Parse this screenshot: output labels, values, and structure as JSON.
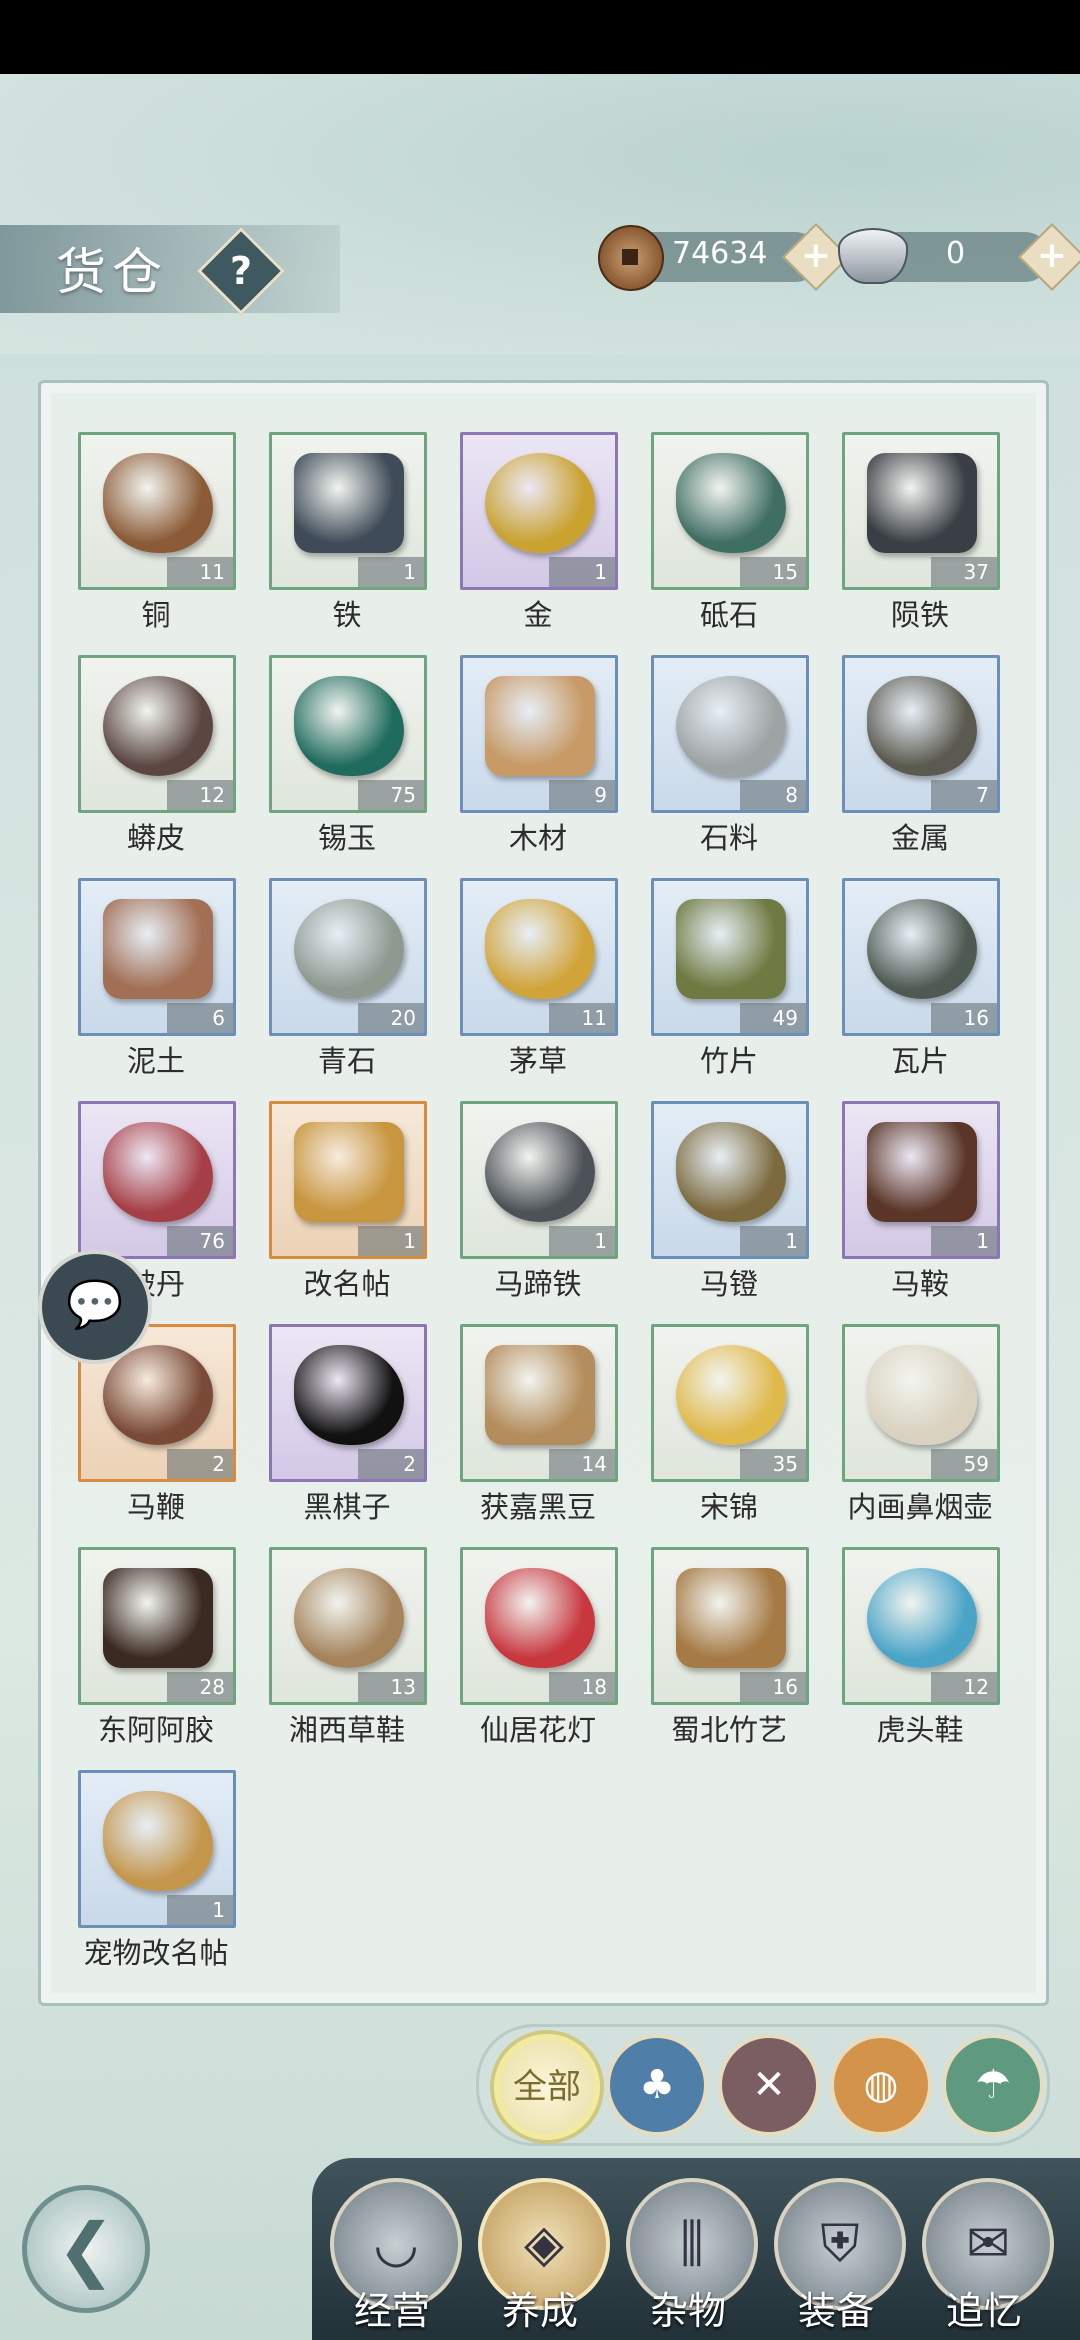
{
  "header": {
    "title": "货仓",
    "help_glyph": "?"
  },
  "currency": {
    "coins": {
      "value": "74634",
      "icon": "copper-coin-icon"
    },
    "silver": {
      "value": "0",
      "icon": "silver-ingot-icon"
    },
    "add_glyph": "+"
  },
  "items": [
    {
      "name": "铜",
      "count": "11",
      "rarity": "green"
    },
    {
      "name": "铁",
      "count": "1",
      "rarity": "green"
    },
    {
      "name": "金",
      "count": "1",
      "rarity": "purple"
    },
    {
      "name": "砥石",
      "count": "15",
      "rarity": "green"
    },
    {
      "name": "陨铁",
      "count": "37",
      "rarity": "green"
    },
    {
      "name": "蟒皮",
      "count": "12",
      "rarity": "green"
    },
    {
      "name": "锡玉",
      "count": "75",
      "rarity": "green"
    },
    {
      "name": "木材",
      "count": "9",
      "rarity": "blue"
    },
    {
      "name": "石料",
      "count": "8",
      "rarity": "blue"
    },
    {
      "name": "金属",
      "count": "7",
      "rarity": "blue"
    },
    {
      "name": "泥土",
      "count": "6",
      "rarity": "blue"
    },
    {
      "name": "青石",
      "count": "20",
      "rarity": "blue"
    },
    {
      "name": "茅草",
      "count": "11",
      "rarity": "blue"
    },
    {
      "name": "竹片",
      "count": "49",
      "rarity": "blue"
    },
    {
      "name": "瓦片",
      "count": "16",
      "rarity": "blue"
    },
    {
      "name": "破丹",
      "count": "76",
      "rarity": "purple"
    },
    {
      "name": "改名帖",
      "count": "1",
      "rarity": "orange"
    },
    {
      "name": "马蹄铁",
      "count": "1",
      "rarity": "green"
    },
    {
      "name": "马镫",
      "count": "1",
      "rarity": "blue"
    },
    {
      "name": "马鞍",
      "count": "1",
      "rarity": "purple"
    },
    {
      "name": "马鞭",
      "count": "2",
      "rarity": "orange"
    },
    {
      "name": "黑棋子",
      "count": "2",
      "rarity": "purple"
    },
    {
      "name": "获嘉黑豆",
      "count": "14",
      "rarity": "green"
    },
    {
      "name": "宋锦",
      "count": "35",
      "rarity": "green"
    },
    {
      "name": "内画鼻烟壶",
      "count": "59",
      "rarity": "green"
    },
    {
      "name": "东阿阿胶",
      "count": "28",
      "rarity": "green"
    },
    {
      "name": "湘西草鞋",
      "count": "13",
      "rarity": "green"
    },
    {
      "name": "仙居花灯",
      "count": "18",
      "rarity": "green"
    },
    {
      "name": "蜀北竹艺",
      "count": "16",
      "rarity": "green"
    },
    {
      "name": "虎头鞋",
      "count": "12",
      "rarity": "green"
    },
    {
      "name": "宠物改名帖",
      "count": "1",
      "rarity": "blue"
    }
  ],
  "filters": [
    {
      "label": "全部",
      "icon": "all-icon",
      "color": "#f2eaa0",
      "active": true
    },
    {
      "label": "",
      "icon": "cloth-bag-icon",
      "color": "#4f7ea8"
    },
    {
      "label": "",
      "icon": "crossed-tools-icon",
      "color": "#7b5e62"
    },
    {
      "label": "",
      "icon": "logs-icon",
      "color": "#d4934a"
    },
    {
      "label": "",
      "icon": "umbrella-icon",
      "color": "#5f9a80"
    }
  ],
  "nav": [
    {
      "label": "经营",
      "icon": "bowl-icon"
    },
    {
      "label": "养成",
      "icon": "seal-icon",
      "active": true
    },
    {
      "label": "杂物",
      "icon": "bundle-icon"
    },
    {
      "label": "装备",
      "icon": "robe-icon"
    },
    {
      "label": "追忆",
      "icon": "letter-icon"
    }
  ],
  "icons": {
    "back": "back-arrow-icon",
    "chat": "chat-icon"
  }
}
